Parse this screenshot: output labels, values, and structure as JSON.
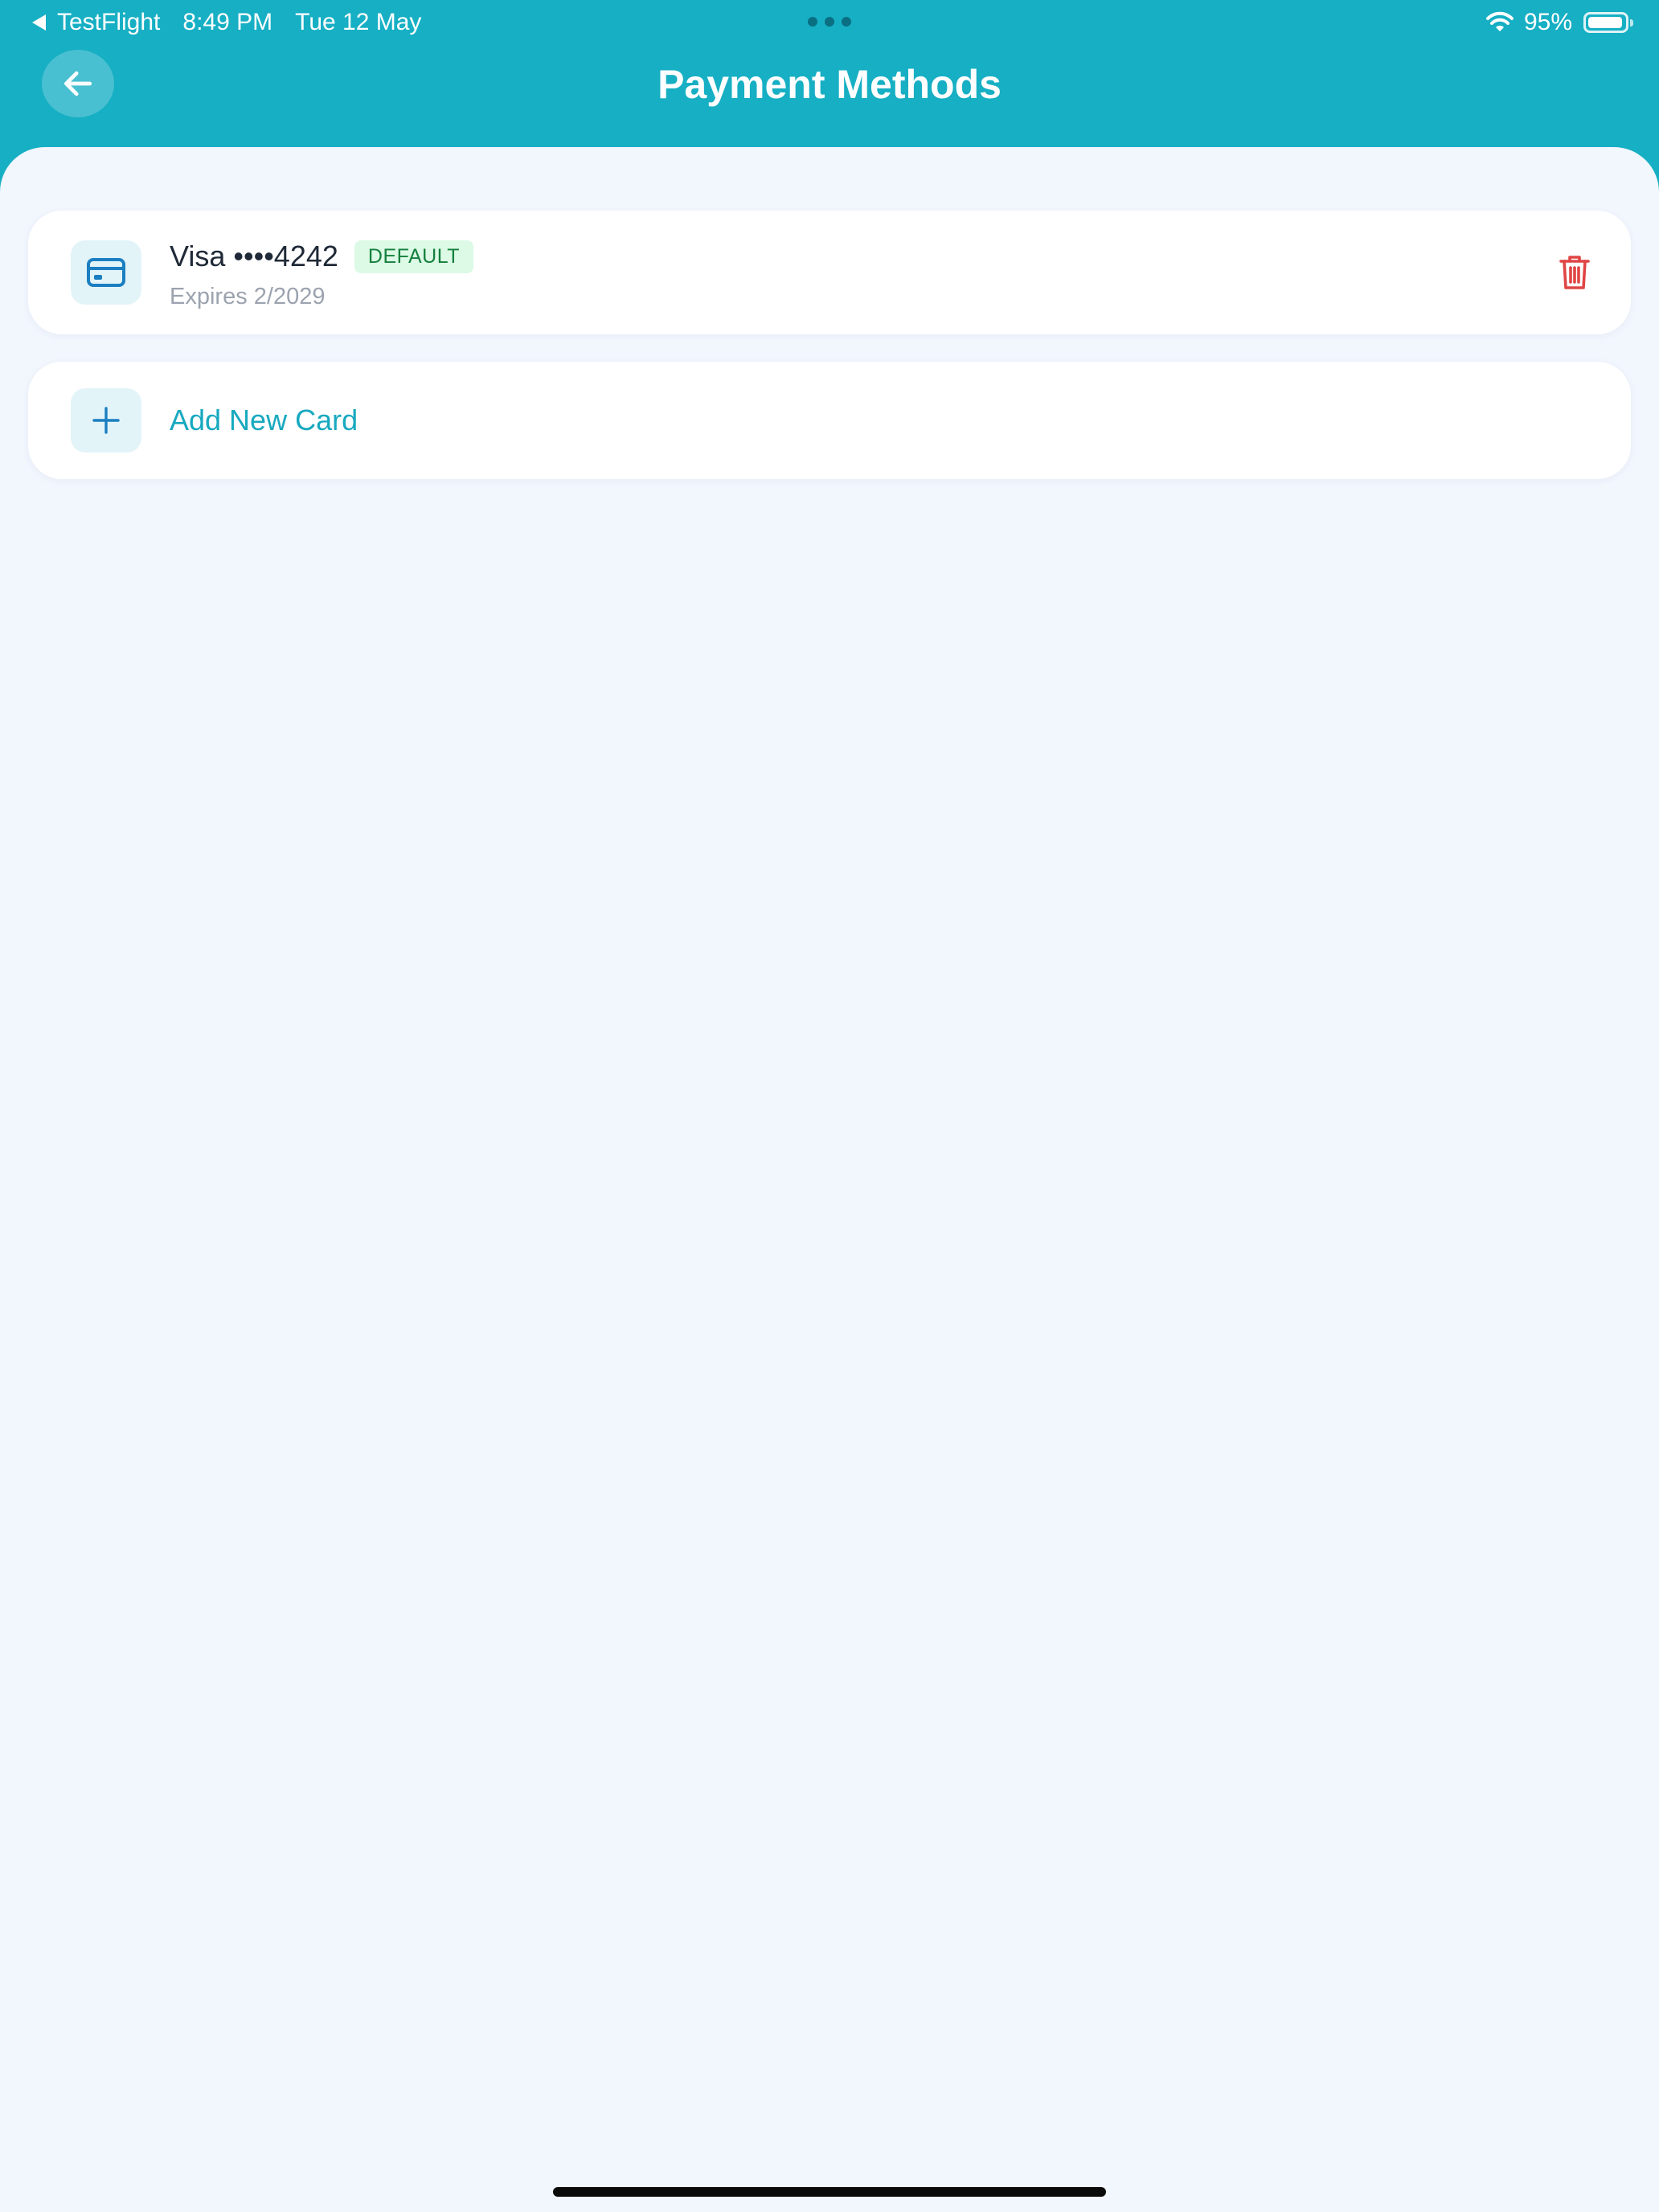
{
  "status_bar": {
    "back_app": "TestFlight",
    "time": "8:49 PM",
    "date": "Tue 12 May",
    "battery_percent": "95%",
    "battery_level": 0.95
  },
  "header": {
    "title": "Payment Methods",
    "back_icon": "arrow-left-icon"
  },
  "cards": [
    {
      "name": "Visa ••••4242",
      "badge": "DEFAULT",
      "expiry": "Expires 2/2029",
      "icon": "credit-card-icon",
      "delete_icon": "trash-icon"
    }
  ],
  "add_card": {
    "label": "Add New Card",
    "icon": "plus-icon"
  },
  "colors": {
    "header_bg": "#16afc4",
    "content_bg": "#f2f6fd",
    "accent": "#17a9bf",
    "card_icon": "#1b7fc1",
    "delete": "#e04545",
    "badge_bg": "#dcfae6",
    "badge_text": "#15803d"
  }
}
